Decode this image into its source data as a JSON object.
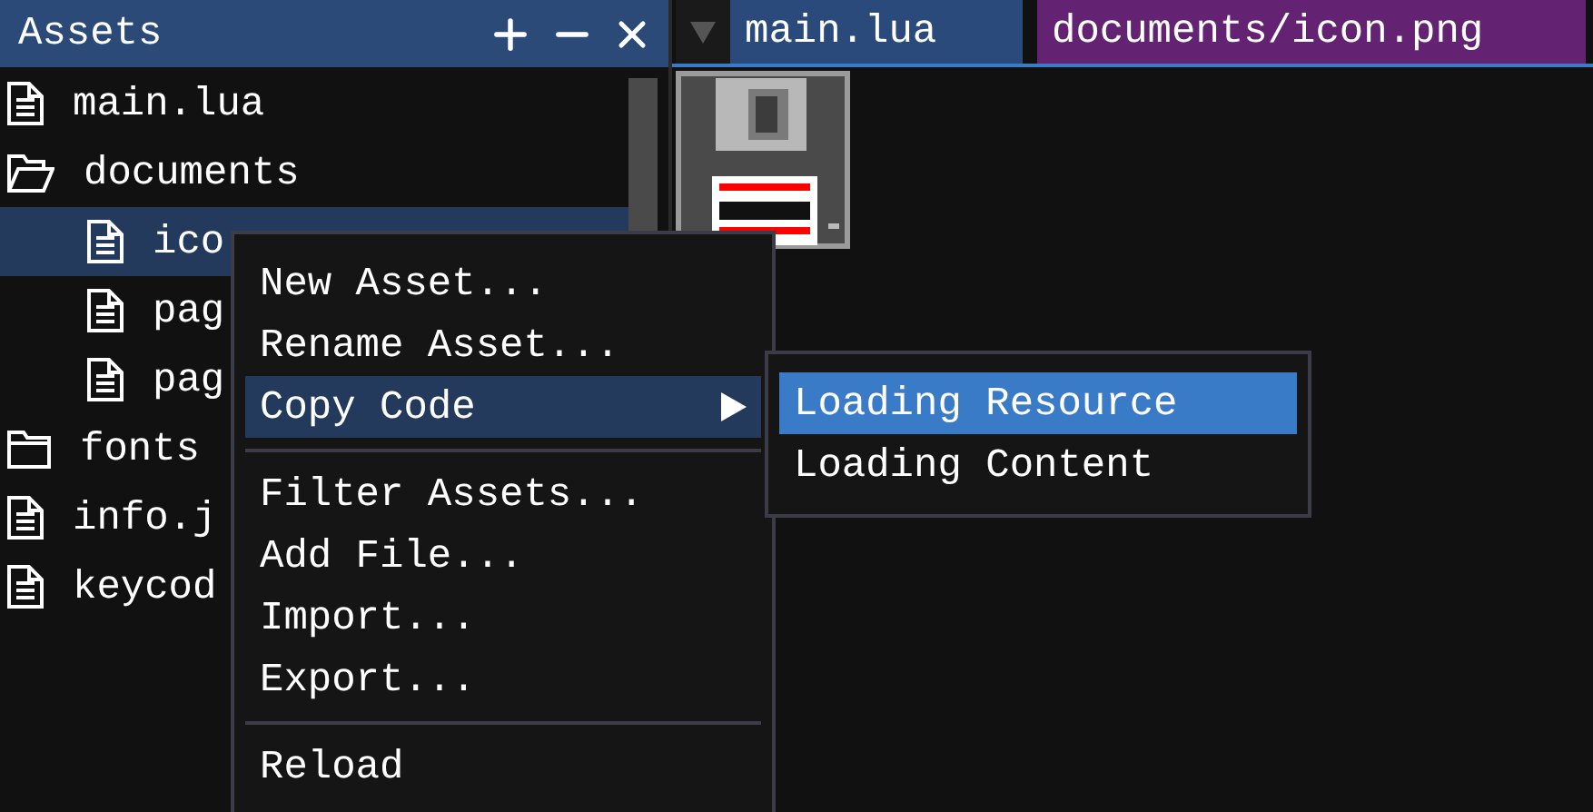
{
  "assets_panel": {
    "title": "Assets",
    "tree": [
      {
        "label": "main.lua",
        "kind": "file",
        "selected": false
      },
      {
        "label": "documents",
        "kind": "folder",
        "expanded": true,
        "selected": false,
        "children": [
          {
            "label": "ico",
            "kind": "file",
            "selected": true
          },
          {
            "label": "pag",
            "kind": "file",
            "selected": false
          },
          {
            "label": "pag",
            "kind": "file",
            "selected": false
          }
        ]
      },
      {
        "label": "fonts",
        "kind": "folder",
        "expanded": false,
        "selected": false
      },
      {
        "label": "info.j",
        "kind": "file",
        "selected": false
      },
      {
        "label": "keycod",
        "kind": "file",
        "selected": false
      }
    ]
  },
  "editor": {
    "tabs": [
      {
        "label": "main.lua",
        "color": "#2b4a7c"
      },
      {
        "label": "documents/icon.png",
        "color": "#632272"
      }
    ]
  },
  "context_menu": {
    "items": [
      {
        "kind": "item",
        "label": "New Asset...",
        "selected": false,
        "submenu": false
      },
      {
        "kind": "item",
        "label": "Rename Asset...",
        "selected": false,
        "submenu": false
      },
      {
        "kind": "item",
        "label": "Copy Code",
        "selected": true,
        "submenu": true
      },
      {
        "kind": "separator"
      },
      {
        "kind": "item",
        "label": "Filter Assets...",
        "selected": false,
        "submenu": false
      },
      {
        "kind": "item",
        "label": "Add File...",
        "selected": false,
        "submenu": false
      },
      {
        "kind": "item",
        "label": "Import...",
        "selected": false,
        "submenu": false
      },
      {
        "kind": "item",
        "label": "Export...",
        "selected": false,
        "submenu": false
      },
      {
        "kind": "separator"
      },
      {
        "kind": "item",
        "label": "Reload",
        "selected": false,
        "submenu": false
      }
    ]
  },
  "submenu": {
    "items": [
      {
        "label": "Loading Resource",
        "selected": true
      },
      {
        "label": "Loading Content",
        "selected": false
      }
    ]
  }
}
